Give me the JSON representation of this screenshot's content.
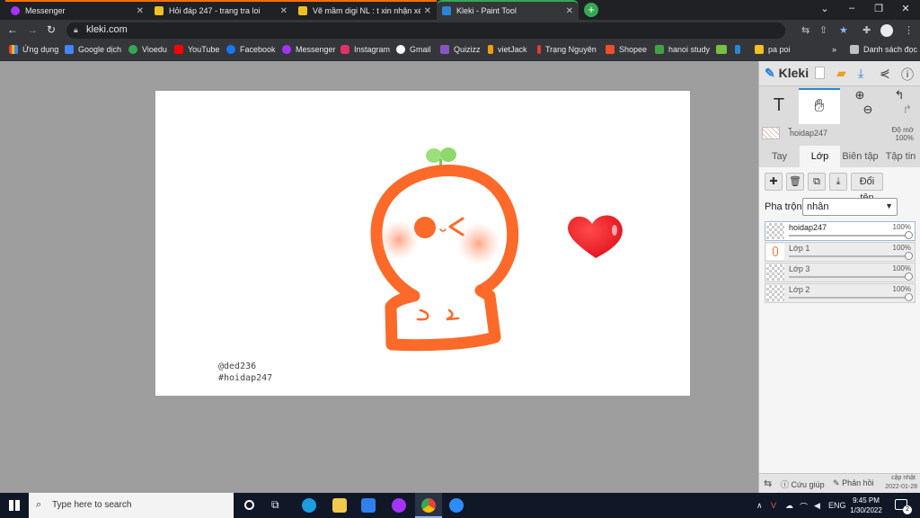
{
  "browser": {
    "tabs": [
      {
        "label": "Messenger",
        "icon_color": "#a334fa",
        "active": false
      },
      {
        "label": "Hỏi đáp 247 - trang tra loi",
        "icon_color": "#f0c020",
        "active": false
      },
      {
        "label": "Vẽ mầm digi NL : t xin nhận xét",
        "icon_color": "#f0c020",
        "active": false
      },
      {
        "label": "Kleki - Paint Tool",
        "icon_color": "#2c84d5",
        "active": true
      }
    ],
    "close_glyph": "✕",
    "new_tab_glyph": "+",
    "url": "kleki.com",
    "bookmarks": [
      {
        "label": "Ứng dụng",
        "icon": "apps-grid-icon",
        "color": "#ea4335"
      },
      {
        "label": "Google dịch",
        "icon": "translate-icon",
        "color": "#4285f4"
      },
      {
        "label": "Vioedu",
        "icon": "vioedu-icon",
        "color": "#34a853"
      },
      {
        "label": "YouTube",
        "icon": "youtube-icon",
        "color": "#ff0000"
      },
      {
        "label": "Facebook",
        "icon": "facebook-icon",
        "color": "#1877f2"
      },
      {
        "label": "Messenger",
        "icon": "messenger-icon",
        "color": "#a334fa"
      },
      {
        "label": "Instagram",
        "icon": "instagram-icon",
        "color": "#e1306c"
      },
      {
        "label": "Gmail",
        "icon": "gmail-icon",
        "color": "#ffffff"
      },
      {
        "label": "Quizizz",
        "icon": "quizizz-icon",
        "color": "#8854c0"
      },
      {
        "label": "vietJack",
        "icon": "vietjack-icon",
        "color": "#f39c12"
      },
      {
        "label": "Trạng Nguyên",
        "icon": "trang-nguyen-icon",
        "color": "#e53935"
      },
      {
        "label": "Shopee",
        "icon": "shopee-icon",
        "color": "#ee4d2d"
      },
      {
        "label": "hanoi study",
        "icon": "hanoi-study-icon",
        "color": "#43a047"
      },
      {
        "label": "pa poi",
        "icon": "pa-poi-icon",
        "color": "#f0c020"
      }
    ],
    "reading_list": "Danh sách đọc"
  },
  "kleki": {
    "logo": "Kleki",
    "layer_name": "hoidap247",
    "opacity_label": "Độ mờ",
    "opacity_value": "100%",
    "tabs": [
      "Tay",
      "Lớp",
      "Biên tập",
      "Tập tin"
    ],
    "active_tab": "Lớp",
    "rename_button": "Đổi tên",
    "blend_label": "Pha trộn",
    "blend_value": "nhân",
    "layers": [
      {
        "name": "hoidap247",
        "opacity": "100%",
        "selected": true
      },
      {
        "name": "Lớp 1",
        "opacity": "100%",
        "selected": false
      },
      {
        "name": "Lớp 3",
        "opacity": "100%",
        "selected": false
      },
      {
        "name": "Lớp 2",
        "opacity": "100%",
        "selected": false
      }
    ],
    "footer": {
      "help": "Cứu giúp",
      "feedback": "Phản hồi",
      "updated_label": "cập nhật",
      "updated_date": "2022-01-28"
    }
  },
  "canvas": {
    "watermark_line1": "@ded236",
    "watermark_line2": "#hoidap247",
    "colors": {
      "orange": "#fc6a2a",
      "blush": "#ffb59a",
      "sprout": "#9be07a",
      "heart": "#ee2b30"
    }
  },
  "taskbar": {
    "search_placeholder": "Type here to search",
    "language": "ENG",
    "time": "9:45 PM",
    "date": "1/30/2022",
    "notification_count": "2"
  }
}
